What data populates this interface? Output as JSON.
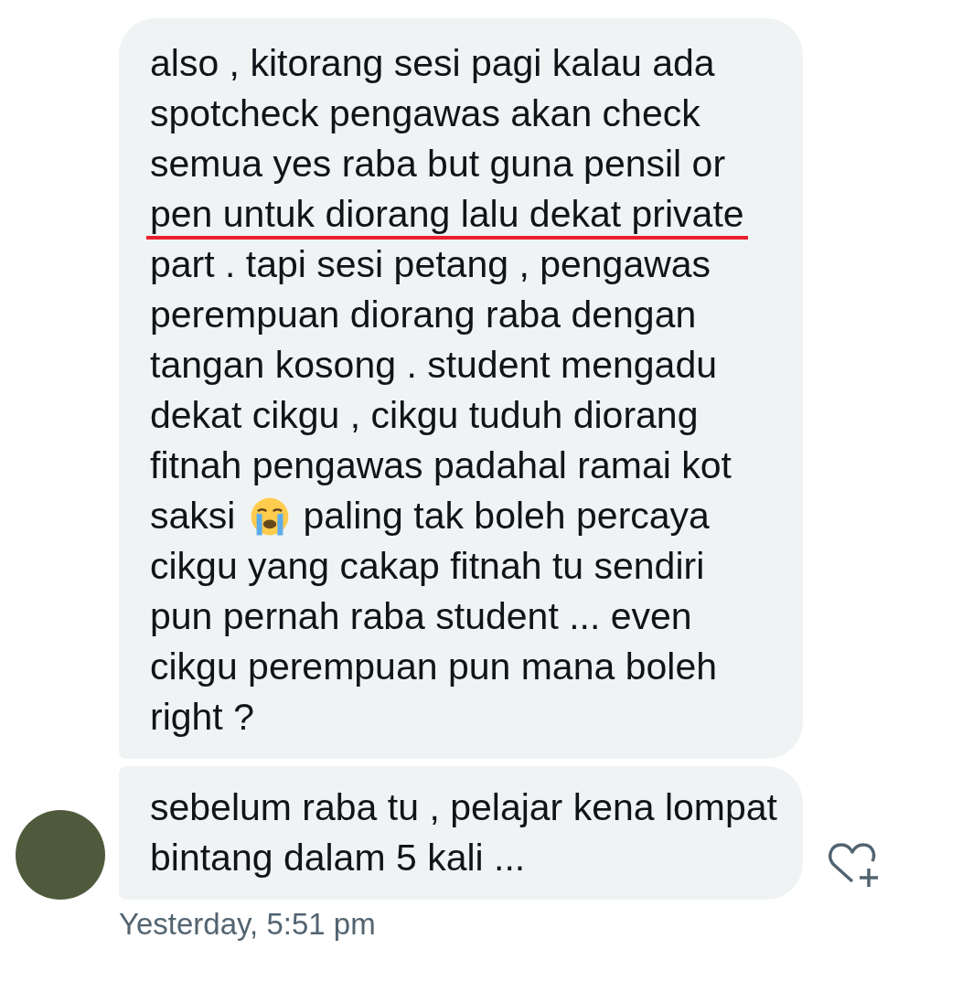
{
  "messages": [
    {
      "avatar": false,
      "segments": [
        {
          "kind": "text",
          "lines": [
            {
              "text": "also , kitorang sesi pagi kalau ada",
              "underlined": false
            },
            {
              "text": "spotcheck pengawas akan check",
              "underlined": false
            },
            {
              "text": "semua yes raba but guna pensil or",
              "underlined": false
            },
            {
              "text": "pen untuk diorang lalu dekat private",
              "underlined": true
            },
            {
              "text": "part . tapi sesi petang , pengawas",
              "underlined": false
            },
            {
              "text": "perempuan diorang raba dengan",
              "underlined": false
            },
            {
              "text": "tangan kosong . student mengadu",
              "underlined": false
            },
            {
              "text": "dekat cikgu , cikgu tuduh diorang",
              "underlined": false
            },
            {
              "text": "fitnah pengawas padahal ramai kot",
              "underlined": false
            }
          ]
        },
        {
          "kind": "row",
          "parts": [
            {
              "kind": "text",
              "text": "saksi"
            },
            {
              "kind": "emoji"
            },
            {
              "kind": "text",
              "text": "paling tak boleh percaya"
            }
          ]
        },
        {
          "kind": "text",
          "lines": [
            {
              "text": "cikgu yang cakap fitnah tu sendiri",
              "underlined": false
            },
            {
              "text": "pun pernah raba student ... even",
              "underlined": false
            },
            {
              "text": "cikgu perempuan pun mana boleh",
              "underlined": false
            },
            {
              "text": "right ?",
              "underlined": false
            }
          ]
        }
      ]
    },
    {
      "avatar": true,
      "segments": [
        {
          "kind": "text",
          "lines": [
            {
              "text": "sebelum raba tu , pelajar kena lompat",
              "underlined": false
            },
            {
              "text": "bintang dalam 5 kali ...",
              "underlined": false
            }
          ]
        }
      ]
    }
  ],
  "timestamp": "Yesterday, 5:51 pm"
}
